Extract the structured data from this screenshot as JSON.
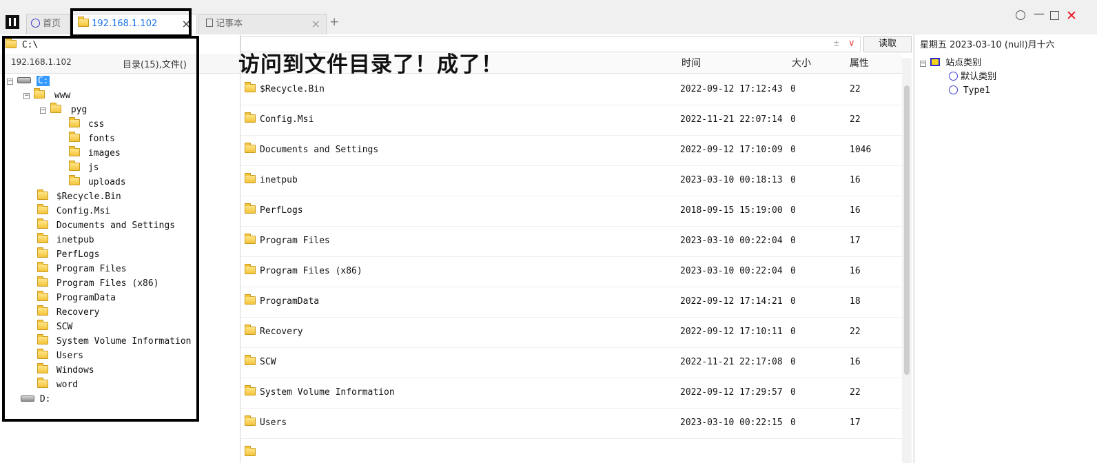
{
  "tabs": [
    {
      "label": "首页"
    },
    {
      "label": "192.168.1.102"
    },
    {
      "label": "记事本"
    }
  ],
  "new_tab": "+",
  "address": {
    "path": "C:\\",
    "read_button": "读取",
    "status": "星期五 2023-03-10 (null)月十六"
  },
  "left": {
    "host": "192.168.1.102",
    "summary": "目录(15),文件(",
    "summary_cut": ")",
    "tree": {
      "c_drive": "C:",
      "www": "www",
      "pyg": "pyg",
      "pyg_children": [
        "css",
        "fonts",
        "images",
        "js",
        "uploads"
      ],
      "c_children": [
        "$Recycle.Bin",
        "Config.Msi",
        "Documents and Settings",
        "inetpub",
        "PerfLogs",
        "Program Files",
        "Program Files (x86)",
        "ProgramData",
        "Recovery",
        "SCW",
        "System Volume Information",
        "Users",
        "Windows",
        "word"
      ],
      "d_drive": "D:"
    }
  },
  "list": {
    "headers": {
      "time": "时间",
      "size": "大小",
      "attr": "属性"
    },
    "rows": [
      {
        "name": "$Recycle.Bin",
        "time": "2022-09-12 17:12:43",
        "size": "0",
        "attr": "22"
      },
      {
        "name": "Config.Msi",
        "time": "2022-11-21 22:07:14",
        "size": "0",
        "attr": "22"
      },
      {
        "name": "Documents and Settings",
        "time": "2022-09-12 17:10:09",
        "size": "0",
        "attr": "1046"
      },
      {
        "name": "inetpub",
        "time": "2023-03-10 00:18:13",
        "size": "0",
        "attr": "16"
      },
      {
        "name": "PerfLogs",
        "time": "2018-09-15 15:19:00",
        "size": "0",
        "attr": "16"
      },
      {
        "name": "Program Files",
        "time": "2023-03-10 00:22:04",
        "size": "0",
        "attr": "17"
      },
      {
        "name": "Program Files (x86)",
        "time": "2023-03-10 00:22:04",
        "size": "0",
        "attr": "16"
      },
      {
        "name": "ProgramData",
        "time": "2022-09-12 17:14:21",
        "size": "0",
        "attr": "18"
      },
      {
        "name": "Recovery",
        "time": "2022-09-12 17:10:11",
        "size": "0",
        "attr": "22"
      },
      {
        "name": "SCW",
        "time": "2022-11-21 22:17:08",
        "size": "0",
        "attr": "16"
      },
      {
        "name": "System Volume Information",
        "time": "2022-09-12 17:29:57",
        "size": "0",
        "attr": "22"
      },
      {
        "name": "Users",
        "time": "2023-03-10 00:22:15",
        "size": "0",
        "attr": "17"
      }
    ]
  },
  "right": {
    "root": "站点类别",
    "children": [
      "默认类别",
      "Type1"
    ]
  },
  "annotation": "访问到文件目录了！成了！",
  "colors": {
    "accent": "#1a73e8",
    "selection": "#3399ff",
    "close": "#e81123"
  }
}
